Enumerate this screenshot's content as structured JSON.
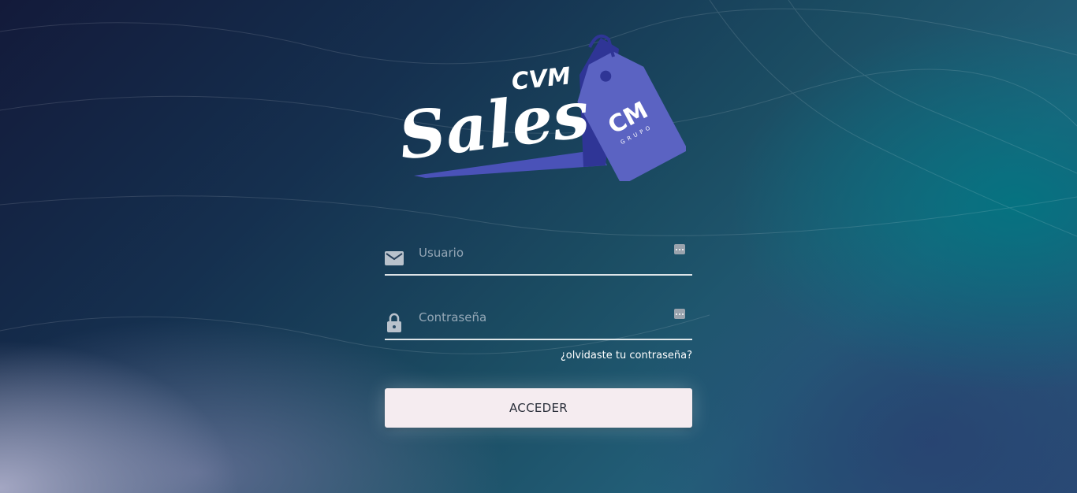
{
  "logo": {
    "brand_small": "CVM",
    "brand_large": "Sales",
    "tag_mark": "CM",
    "tag_sub": "GRUPO",
    "colors": {
      "tag": "#5b63c2",
      "tag_dark": "#2f3596",
      "swoosh": "#4a52b8",
      "text": "#ffffff"
    }
  },
  "login": {
    "username_placeholder": "Usuario",
    "password_placeholder": "Contraseña",
    "forgot_label": "¿olvidaste tu contraseña?",
    "submit_label": "ACCEDER",
    "username_icon": "mail-icon",
    "password_icon": "lock-icon"
  },
  "colors": {
    "button_bg": "#f5ecf0",
    "button_text": "#2a2f3a",
    "underline": "#ffffff"
  }
}
